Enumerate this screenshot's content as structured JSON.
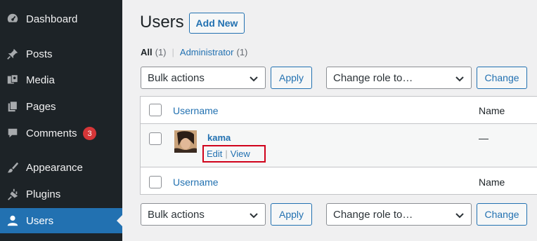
{
  "sidebar": {
    "items": [
      {
        "label": "Dashboard",
        "icon": "dashboard-icon",
        "badge": ""
      },
      {
        "label": "Posts",
        "icon": "pin-icon",
        "badge": ""
      },
      {
        "label": "Media",
        "icon": "media-icon",
        "badge": ""
      },
      {
        "label": "Pages",
        "icon": "pages-icon",
        "badge": ""
      },
      {
        "label": "Comments",
        "icon": "comment-icon",
        "badge": "3"
      },
      {
        "label": "Appearance",
        "icon": "brush-icon",
        "badge": ""
      },
      {
        "label": "Plugins",
        "icon": "plugin-icon",
        "badge": ""
      },
      {
        "label": "Users",
        "icon": "user-icon",
        "badge": "",
        "active": true
      }
    ],
    "colors": {
      "bg": "#1d2327",
      "active": "#2271b1",
      "badge": "#d63638"
    }
  },
  "header": {
    "title": "Users",
    "add_new": "Add New"
  },
  "filters": {
    "all": "All",
    "all_count": "(1)",
    "separator": "|",
    "administrator": "Administrator",
    "administrator_count": "(1)"
  },
  "toolbar_top": {
    "bulk_actions": "Bulk actions",
    "apply": "Apply",
    "change_role": "Change role to…",
    "change": "Change"
  },
  "toolbar_bottom": {
    "bulk_actions": "Bulk actions",
    "apply": "Apply",
    "change_role": "Change role to…",
    "change": "Change"
  },
  "table": {
    "columns": {
      "username": "Username",
      "name": "Name"
    },
    "rows": [
      {
        "username": "kama",
        "name": "—",
        "actions": {
          "edit": "Edit",
          "separator": "|",
          "view": "View"
        }
      }
    ]
  },
  "accent": "#2271b1",
  "highlight": "#d0021b"
}
